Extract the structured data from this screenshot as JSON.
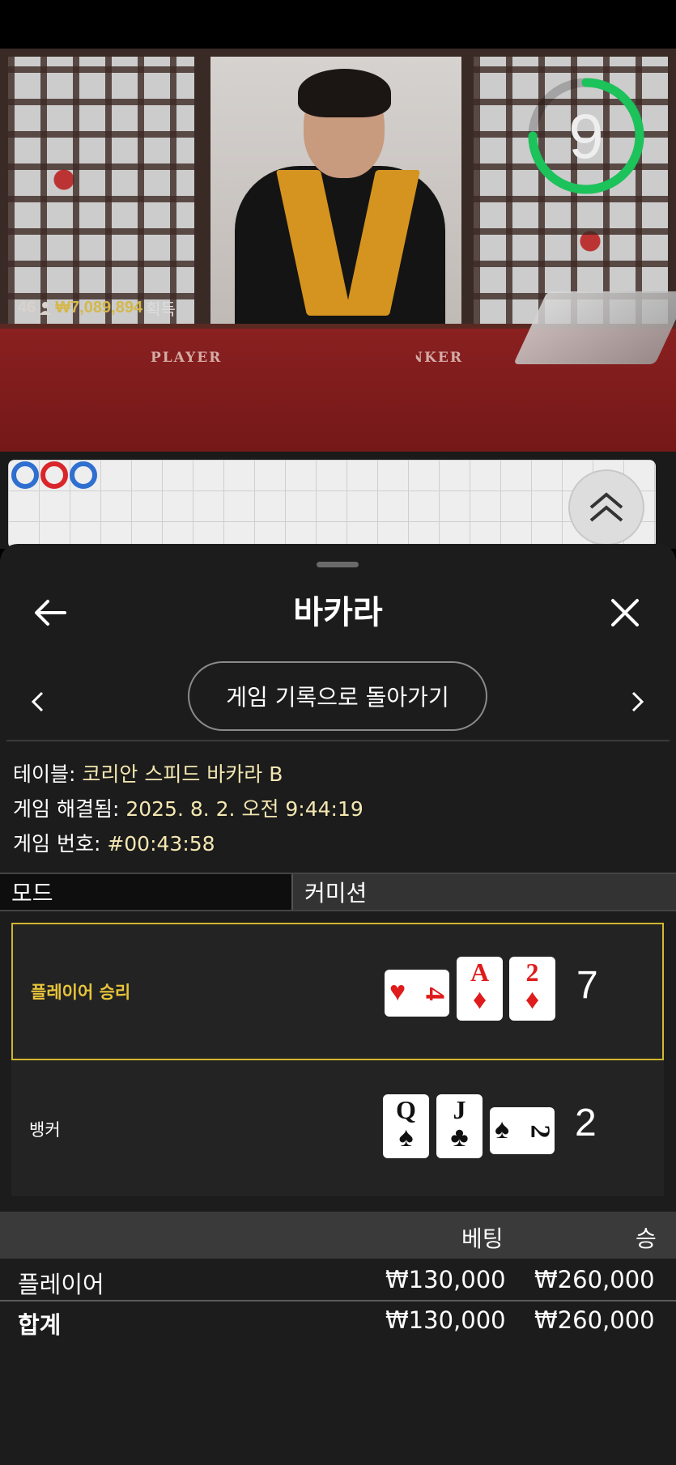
{
  "video": {
    "timer_value": "9",
    "timer_progress": 0.75,
    "player_count": "46",
    "winnings": "₩7,089,894",
    "winnings_suffix": "획득",
    "felt_player": "PLAYER",
    "felt_banker": "BANKER"
  },
  "colors": {
    "accent_gold": "#d1b62e",
    "timer_green": "#1cc25a",
    "road_red": "#d9262b",
    "road_blue": "#2f6fd0"
  },
  "sheet": {
    "title": "바카라",
    "back_to_history": "게임 기록으로 돌아가기",
    "info": {
      "table_label": "테이블:",
      "table_value": "코리안 스피드 바카라 B",
      "resolved_label": "게임 해결됨:",
      "resolved_value": "2025. 8. 2. 오전 9:44:19",
      "number_label": "게임 번호:",
      "number_value": "#00:43:58"
    },
    "tabs": {
      "mode": "모드",
      "commission": "커미션"
    },
    "player_hand": {
      "label": "플레이어 승리",
      "score": "7",
      "cards": [
        {
          "rank": "4",
          "suit": "♥"
        },
        {
          "rank": "A",
          "suit": "♦"
        },
        {
          "rank": "2",
          "suit": "♦"
        }
      ]
    },
    "banker_hand": {
      "label": "뱅커",
      "score": "2",
      "cards": [
        {
          "rank": "Q",
          "suit": "♠"
        },
        {
          "rank": "J",
          "suit": "♣"
        },
        {
          "rank": "2",
          "suit": "♠"
        }
      ]
    },
    "bets": {
      "col_bet": "베팅",
      "col_win": "승",
      "rows": [
        {
          "name": "플레이어",
          "bet": "₩130,000",
          "win": "₩260,000"
        },
        {
          "name": "합계",
          "bet": "₩130,000",
          "win": "₩260,000"
        }
      ]
    }
  }
}
